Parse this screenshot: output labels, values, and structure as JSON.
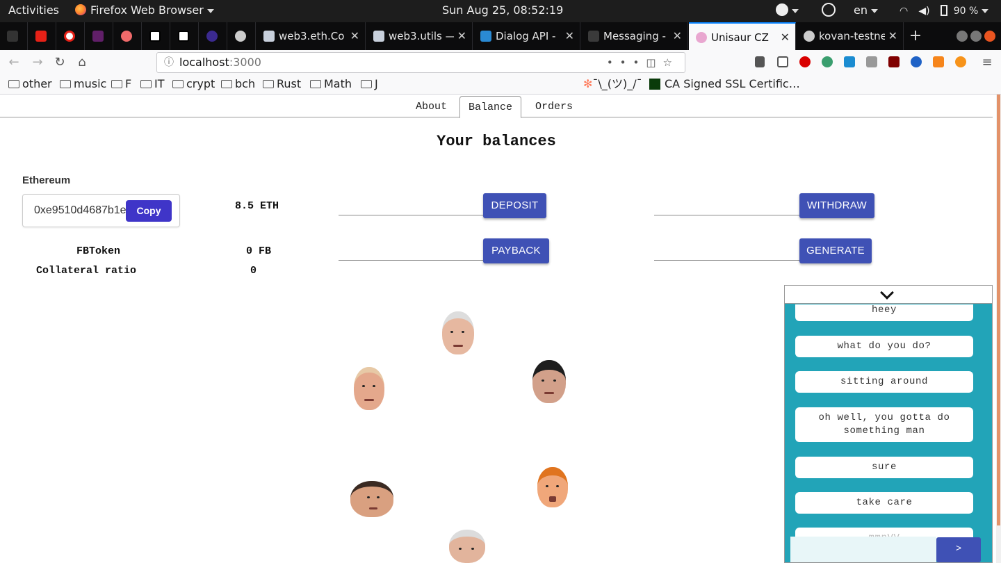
{
  "topbar": {
    "activities": "Activities",
    "app_name": "Firefox Web Browser",
    "clock": "Sun Aug 25, 08:52:19",
    "lang": "en",
    "battery": "90 %"
  },
  "tabs": [
    {
      "title": "web3.eth.Co",
      "icon": "document-icon"
    },
    {
      "title": "web3.utils —",
      "icon": "document-icon"
    },
    {
      "title": "Dialog API -",
      "icon": "vscode-icon"
    },
    {
      "title": "Messaging -",
      "icon": "number-icon"
    },
    {
      "title": "Unisaur CZ",
      "icon": "unicorn-icon",
      "active": true
    },
    {
      "title": "kovan-testne",
      "icon": "github-icon"
    }
  ],
  "url": {
    "host": "localhost",
    "port": ":3000"
  },
  "bookmarks": [
    "other",
    "music",
    "F",
    "IT",
    "crypt",
    "bch",
    "Rust",
    "Math",
    "J",
    "¯\\_(ツ)_/¯",
    "CA Signed SSL Certific…"
  ],
  "colors": {
    "accent": "#3f51b5",
    "copy": "#3f35c8",
    "chat_bg": "#22a4b8",
    "scroll": "#e07b47"
  },
  "app": {
    "nav": [
      "About",
      "Balance",
      "Orders"
    ],
    "active_nav": "Balance",
    "title": "Your balances",
    "ethereum_label": "Ethereum",
    "address": "0xe9510d4687b1e",
    "copy_label": "Copy",
    "eth_balance": "8.5 ETH",
    "fb_label": "FBToken",
    "fb_balance": "0 FB",
    "collateral_label": "Collateral ratio",
    "collateral_value": "0",
    "buttons": {
      "deposit": "DEPOSIT",
      "withdraw": "WITHDRAW",
      "payback": "PAYBACK",
      "generate": "GENERATE"
    }
  },
  "chat": {
    "messages": [
      "heey",
      "what do you do?",
      "sitting around",
      "oh well, you gotta do something man",
      "sure",
      "take care",
      "mmnVV"
    ],
    "send_label": ">"
  }
}
